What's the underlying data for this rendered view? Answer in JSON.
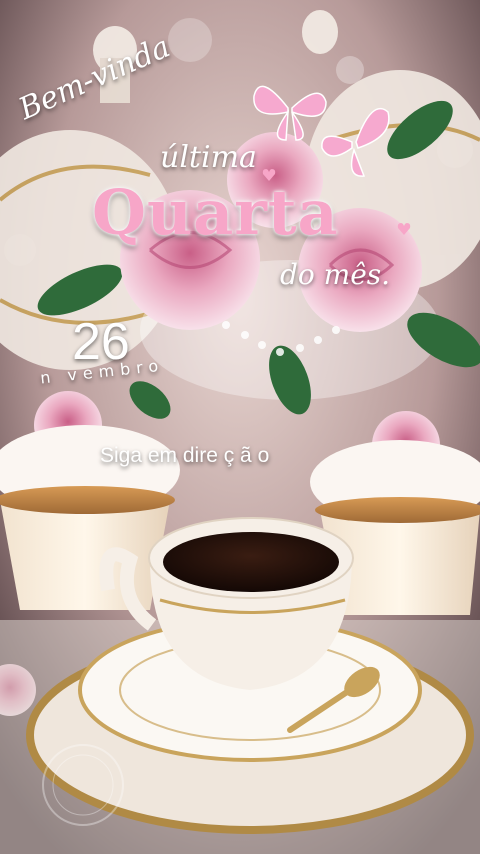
{
  "greeting": {
    "line1": "Bem-vinda",
    "line2": "última",
    "day_name": "Quarta",
    "line4": "do mês."
  },
  "date": {
    "day": "26",
    "month": "n   vembro"
  },
  "phrase": "Siga em dire ç      ã          o",
  "colors": {
    "accent_pink": "#f7a6c8",
    "coffee": "#1e0f0a",
    "porcelain": "#f3ece4",
    "gold": "#c9a45c"
  },
  "icons": [
    "butterfly-icon",
    "heart-icon",
    "rose-icon"
  ]
}
